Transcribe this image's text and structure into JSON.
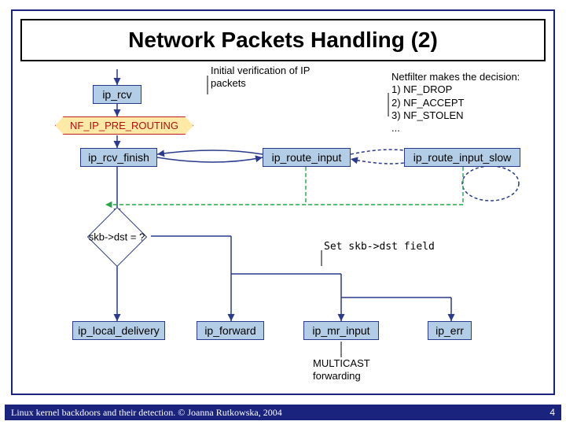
{
  "title": "Network Packets Handling (2)",
  "boxes": {
    "ip_rcv": "ip_rcv",
    "nf_ip_pre_routing": "NF_IP_PRE_ROUTING",
    "ip_rcv_finish": "ip_rcv_finish",
    "ip_route_input": "ip_route_input",
    "ip_route_input_slow": "ip_route_input_slow",
    "ip_local_delivery": "ip_local_delivery",
    "ip_forward": "ip_forward",
    "ip_mr_input": "ip_mr_input",
    "ip_err": "ip_err"
  },
  "diamond": "skb->dst = ?",
  "notes": {
    "initial_verification": "Initial verification of IP packets",
    "netfilter": "Netfilter makes the decision:\n1) NF_DROP\n2) NF_ACCEPT\n3) NF_STOLEN\n...",
    "set_skb_dst": "Set skb->dst field",
    "multicast": "MULTICAST forwarding"
  },
  "footer": {
    "text": "Linux kernel backdoors and their detection. © Joanna Rutkowska, 2004",
    "page": "4"
  }
}
